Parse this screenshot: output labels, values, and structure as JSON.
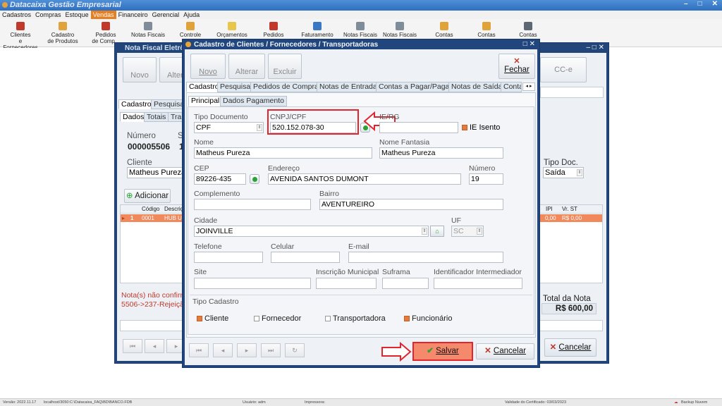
{
  "app": {
    "title": "Datacaixa Gestão Empresarial",
    "menu": [
      "Cadastros",
      "Compras",
      "Estoque",
      "Vendas",
      "Financeiro",
      "Gerencial",
      "Ajuda"
    ],
    "active_menu": "Vendas",
    "window_controls": [
      "–",
      "□",
      "✕"
    ]
  },
  "toolbar": [
    {
      "label": "Clientes\ne Fornecedores",
      "icon": "users-icon"
    },
    {
      "label": "Cadastro\nde Produtos",
      "icon": "boxes-icon"
    },
    {
      "label": "Pedidos\nde Comp...",
      "icon": "order-icon"
    },
    {
      "label": "Notas Fiscais",
      "icon": "invoice-icon"
    },
    {
      "label": "Controle",
      "icon": "control-icon"
    },
    {
      "label": "Orçamentos",
      "icon": "quote-icon"
    },
    {
      "label": "Pedidos",
      "icon": "orders-icon"
    },
    {
      "label": "Faturamento",
      "icon": "billing-icon"
    },
    {
      "label": "Notas Fiscais",
      "icon": "invoice-icon"
    },
    {
      "label": "Notas Fiscais",
      "icon": "invoice-icon"
    },
    {
      "label": "Contas",
      "icon": "accounts-icon"
    },
    {
      "label": "Contas",
      "icon": "accounts-icon"
    },
    {
      "label": "Contas",
      "icon": "accounts-icon"
    }
  ],
  "status_bar": {
    "version": "Versão: 2022.11.17",
    "db": "localhost/3050:C:\\Datacaixa_FAQ\\BD\\BANCO.FDB",
    "user": "Usuário: adm",
    "printer": "Impressora:",
    "cert": "Validade do Certificado: 03/03/2023",
    "backup": "Backup Nuvem"
  },
  "nf_window": {
    "title": "Nota Fiscal Eletrô...",
    "buttons": {
      "novo": "Novo",
      "alterar": "Alter",
      "cce": "CC-e",
      "cancelar": "Cancelar"
    },
    "tabs_top": [
      "Cadastro",
      "Pesquisar"
    ],
    "tabs_sub": [
      "Dados",
      "Totais",
      "Tran"
    ],
    "numero_label": "Número",
    "numero_value": "000005506",
    "serie_label": "S",
    "serie_value": "1",
    "cliente_label": "Cliente",
    "cliente_value": "Matheus Pureza",
    "tipo_doc_label": "Tipo Doc.",
    "tipo_doc_value": "Saída",
    "adicionar_label": "Adicionar",
    "grid_headers": [
      "Código",
      "Descriç",
      "IPI",
      "Vr. ST"
    ],
    "grid_row": {
      "index": "1",
      "codigo": "0001",
      "descricao": "HUB U",
      "ipi": "0,00",
      "vr_st": "R$ 0,00"
    },
    "msg_line1": "Nota(s) não confirmada",
    "msg_line2": "5506->237-Rejeição: C",
    "total_label": "Total da Nota",
    "total_value": "R$ 600,00"
  },
  "modal": {
    "title": "Cadastro de Clientes / Fornecedores / Transportadoras",
    "buttons": {
      "novo": "Novo",
      "alterar": "Alterar",
      "excluir": "Excluir",
      "fechar": "Fechar",
      "salvar": "Salvar",
      "cancelar": "Cancelar"
    },
    "tabs": [
      "Cadastro",
      "Pesquisar",
      "Pedidos de Compra",
      "Notas de Entrada",
      "Contas a Pagar/Pagas",
      "Notas de Saída",
      "Conta"
    ],
    "subtabs": [
      "Principal",
      "Dados Pagamento"
    ],
    "fields": {
      "tipo_documento": {
        "label": "Tipo Documento",
        "value": "CPF"
      },
      "cnpj_cpf": {
        "label": "CNPJ/CPF",
        "value": "520.152.078-30"
      },
      "ie_rg": {
        "label": "IE/RG",
        "value": ""
      },
      "ie_isento": {
        "label": "IE Isento",
        "checked": true
      },
      "nome": {
        "label": "Nome",
        "value": "Matheus Pureza"
      },
      "nome_fantasia": {
        "label": "Nome Fantasia",
        "value": "Matheus Pureza"
      },
      "cep": {
        "label": "CEP",
        "value": "89226-435"
      },
      "endereco": {
        "label": "Endereço",
        "value": "AVENIDA SANTOS DUMONT"
      },
      "numero": {
        "label": "Número",
        "value": "19"
      },
      "complemento": {
        "label": "Complemento",
        "value": ""
      },
      "bairro": {
        "label": "Bairro",
        "value": "AVENTUREIRO"
      },
      "cidade": {
        "label": "Cidade",
        "value": "JOINVILLE"
      },
      "uf": {
        "label": "UF",
        "value": "SC"
      },
      "telefone": {
        "label": "Telefone",
        "value": ""
      },
      "celular": {
        "label": "Celular",
        "value": ""
      },
      "email": {
        "label": "E-mail",
        "value": ""
      },
      "site": {
        "label": "Site",
        "value": ""
      },
      "inscricao_municipal": {
        "label": "Inscrição Municipal",
        "value": ""
      },
      "suframa": {
        "label": "Suframa",
        "value": ""
      },
      "identificador": {
        "label": "Identificador Intermediador",
        "value": ""
      }
    },
    "tipo_cadastro": {
      "label": "Tipo Cadastro",
      "options": [
        {
          "label": "Cliente",
          "checked": true
        },
        {
          "label": "Fornecedor",
          "checked": false
        },
        {
          "label": "Transportadora",
          "checked": false
        },
        {
          "label": "Funcionário",
          "checked": true
        }
      ]
    }
  },
  "colors": {
    "accent_orange": "#e67e22",
    "window_blue": "#21467e",
    "highlight_red": "#e2242c",
    "save_green": "#2aa235"
  }
}
